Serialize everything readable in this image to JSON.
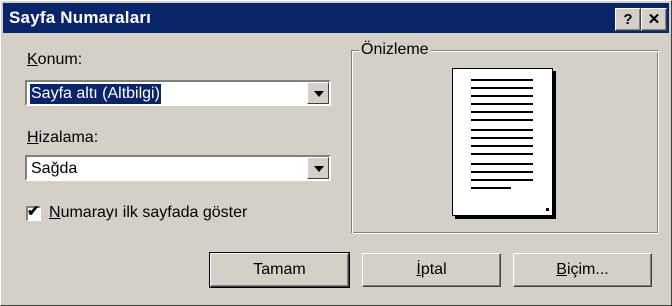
{
  "title": "Sayfa Numaraları",
  "titlebar_buttons": {
    "help": "?",
    "close": "✕"
  },
  "konum": {
    "label_u": "K",
    "label_rest": "onum:",
    "value": "Sayfa altı (Altbilgi)"
  },
  "hizalama": {
    "label_u": "H",
    "label_rest": "izalama:",
    "value": "Sağda"
  },
  "preview": {
    "legend": "Önizleme"
  },
  "show_first": {
    "checked": true,
    "mark": "✔",
    "label_u": "N",
    "label_rest": "umarayı ilk sayfada göster"
  },
  "buttons": {
    "ok": "Tamam",
    "cancel_u": "İ",
    "cancel_rest": "ptal",
    "format_u": "B",
    "format_rest": "içim..."
  }
}
